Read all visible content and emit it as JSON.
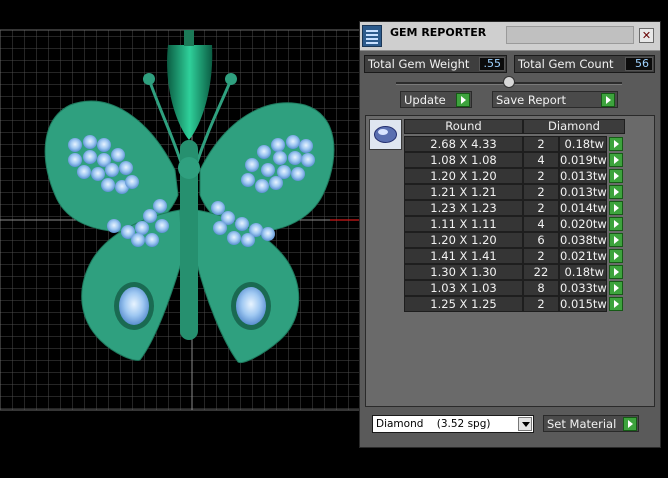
{
  "panel": {
    "title": "GEM REPORTER",
    "close_glyph": "✕",
    "total_weight_label": "Total Gem Weight",
    "total_weight_value": ".55",
    "total_count_label": "Total Gem Count",
    "total_count_value": "56",
    "update_label": "Update",
    "save_label": "Save Report",
    "table": {
      "headers": [
        "Round",
        "Diamond"
      ],
      "rows": [
        {
          "size": "2.68 X 4.33",
          "count": "2",
          "weight": "0.18tw"
        },
        {
          "size": "1.08 X 1.08",
          "count": "4",
          "weight": "0.019tw"
        },
        {
          "size": "1.20 X 1.20",
          "count": "2",
          "weight": "0.013tw"
        },
        {
          "size": "1.21 X 1.21",
          "count": "2",
          "weight": "0.013tw"
        },
        {
          "size": "1.23 X 1.23",
          "count": "2",
          "weight": "0.014tw"
        },
        {
          "size": "1.11 X 1.11",
          "count": "4",
          "weight": "0.020tw"
        },
        {
          "size": "1.20 X 1.20",
          "count": "6",
          "weight": "0.038tw"
        },
        {
          "size": "1.41 X 1.41",
          "count": "2",
          "weight": "0.021tw"
        },
        {
          "size": "1.30 X 1.30",
          "count": "22",
          "weight": "0.18tw"
        },
        {
          "size": "1.03 X 1.03",
          "count": "8",
          "weight": "0.033tw"
        },
        {
          "size": "1.25 X 1.25",
          "count": "2",
          "weight": "0.015tw"
        }
      ]
    },
    "material_value": "Diamond    (3.52 spg)",
    "set_material_label": "Set Material"
  },
  "icons": {
    "title": "report-icon",
    "close": "close-icon",
    "go": "play-arrow-icon",
    "gem": "oval-gem-icon",
    "dropdown": "chevron-down-icon"
  },
  "colors": {
    "butterfly": "#2fa07f",
    "gem": "#9fc8f2",
    "grid": "#5a5a5a",
    "go_button": "#3da33d",
    "value_text": "#9fd2ff"
  }
}
